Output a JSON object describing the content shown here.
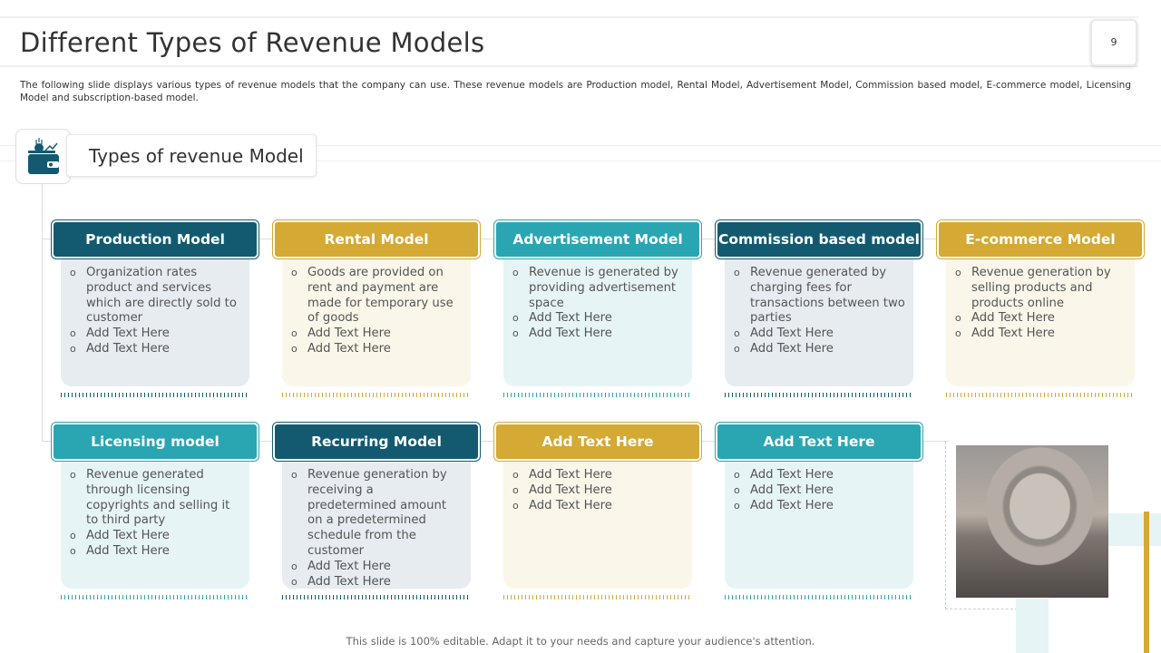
{
  "title": "Different Types of Revenue Models",
  "page_number": "9",
  "description": "The following slide displays various types of revenue models that the company can use. These revenue models are Production model, Rental Model, Advertisement Model, Commission based model, E-commerce model, Licensing Model and subscription-based model.",
  "section_title": "Types of revenue Model",
  "cards": [
    {
      "title": "Production Model",
      "items": [
        "Organization rates product and services which are directly sold to customer",
        "Add Text Here",
        "Add Text Here"
      ]
    },
    {
      "title": "Rental Model",
      "items": [
        "Goods are provided on rent and payment are made for temporary use of goods",
        "Add Text Here",
        "Add Text Here"
      ]
    },
    {
      "title": "Advertisement Model",
      "items": [
        "Revenue is generated by providing advertisement space",
        "Add Text Here",
        "Add Text Here"
      ]
    },
    {
      "title": "Commission based model",
      "items": [
        "Revenue generated by charging fees for transactions between two parties",
        "Add Text Here",
        "Add Text Here"
      ]
    },
    {
      "title": "E-commerce Model",
      "items": [
        "Revenue generation by selling products and products online",
        "Add Text Here",
        "Add Text Here"
      ]
    },
    {
      "title": "Licensing model",
      "items": [
        "Revenue generated through licensing copyrights and selling it to third party",
        "Add Text Here",
        "Add Text Here"
      ]
    },
    {
      "title": "Recurring Model",
      "items": [
        "Revenue generation by receiving a predetermined amount on a predetermined schedule from the customer",
        "Add Text Here",
        "Add Text Here"
      ]
    },
    {
      "title": "Add Text Here",
      "items": [
        "Add Text Here",
        "Add Text Here",
        "Add Text Here"
      ]
    },
    {
      "title": "Add Text Here",
      "items": [
        "Add Text Here",
        "Add Text Here",
        "Add Text Here"
      ]
    }
  ],
  "footer": "This slide is 100% editable. Adapt it to your needs and capture your audience's attention.",
  "colors": {
    "dark": "#135a70",
    "gold": "#d4a934",
    "teal": "#2aa6b2"
  }
}
